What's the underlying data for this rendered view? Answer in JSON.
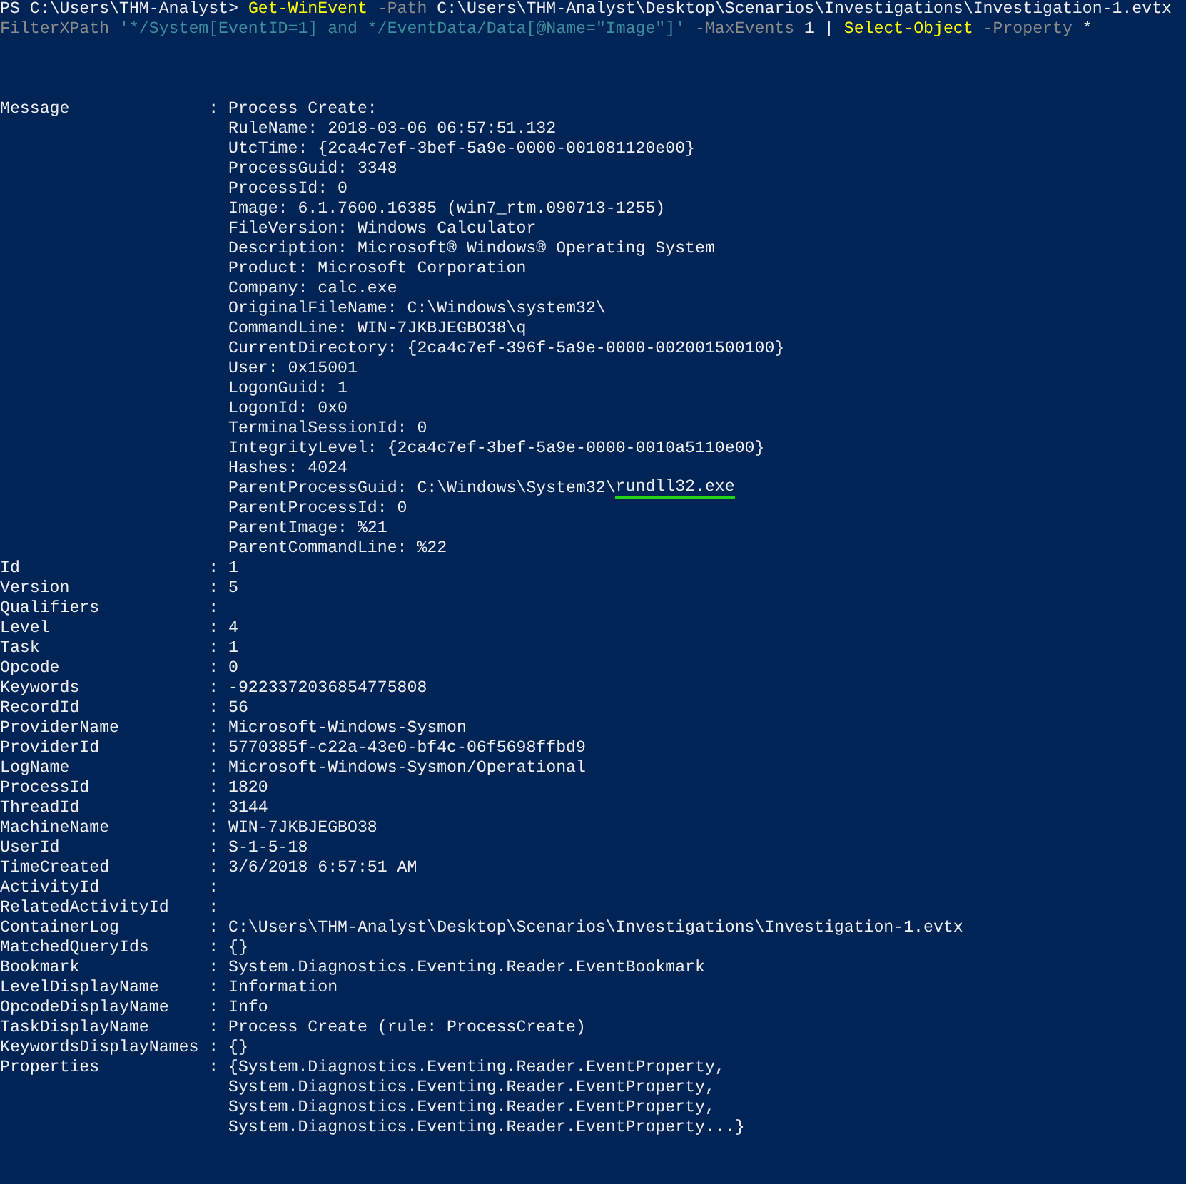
{
  "command": [
    [
      {
        "kind": "prompt",
        "text": "PS C:\\Users\\THM-Analyst> "
      },
      {
        "kind": "cmdlet",
        "text": "Get-WinEvent"
      },
      {
        "kind": "parameter",
        "text": " -Path"
      },
      {
        "kind": "argument",
        "text": " C:\\Users\\THM-Analyst\\Desktop\\Scenarios\\Investigations\\Investigation-1.evtx"
      }
    ],
    [
      {
        "kind": "parameter",
        "text": "FilterXPath"
      },
      {
        "kind": "string",
        "text": " '*/System[EventID=1] and */EventData/Data[@Name=\"Image\"]'"
      },
      {
        "kind": "parameter",
        "text": " -MaxEvents"
      },
      {
        "kind": "argument",
        "text": " 1"
      },
      {
        "kind": "argument",
        "text": " |"
      },
      {
        "kind": "cmdlet",
        "text": " Select-Object"
      },
      {
        "kind": "parameter",
        "text": " -Property"
      },
      {
        "kind": "argument",
        "text": " *"
      }
    ]
  ],
  "properties": [
    {
      "name": "Message",
      "sep": ":",
      "lines": [
        "Process Create:",
        "RuleName: 2018-03-06 06:57:51.132",
        "UtcTime: {2ca4c7ef-3bef-5a9e-0000-001081120e00}",
        "ProcessGuid: 3348",
        "ProcessId: 0",
        "Image: 6.1.7600.16385 (win7_rtm.090713-1255)",
        "FileVersion: Windows Calculator",
        "Description: Microsoft® Windows® Operating System",
        "Product: Microsoft Corporation",
        "Company: calc.exe",
        "OriginalFileName: C:\\Windows\\system32\\",
        "CommandLine: WIN-7JKBJEGBO38\\q",
        "CurrentDirectory: {2ca4c7ef-396f-5a9e-0000-002001500100}",
        "User: 0x15001",
        "LogonGuid: 1",
        "LogonId: 0x0",
        "TerminalSessionId: 0",
        "IntegrityLevel: {2ca4c7ef-3bef-5a9e-0000-0010a5110e00}",
        "Hashes: 4024",
        [
          {
            "text": "ParentProcessGuid: C:\\Windows\\System32\\",
            "underlined": false
          },
          {
            "text": "rundll32.exe",
            "underlined": true
          }
        ],
        "ParentProcessId: 0",
        "ParentImage: %21",
        "ParentCommandLine: %22"
      ]
    },
    {
      "name": "Id",
      "sep": ":",
      "lines": [
        "1"
      ]
    },
    {
      "name": "Version",
      "sep": ":",
      "lines": [
        "5"
      ]
    },
    {
      "name": "Qualifiers",
      "sep": ":"
    },
    {
      "name": "Level",
      "sep": ":",
      "lines": [
        "4"
      ]
    },
    {
      "name": "Task",
      "sep": ":",
      "lines": [
        "1"
      ]
    },
    {
      "name": "Opcode",
      "sep": ":",
      "lines": [
        "0"
      ]
    },
    {
      "name": "Keywords",
      "sep": ":",
      "lines": [
        "-9223372036854775808"
      ]
    },
    {
      "name": "RecordId",
      "sep": ":",
      "lines": [
        "56"
      ]
    },
    {
      "name": "ProviderName",
      "sep": ":",
      "lines": [
        "Microsoft-Windows-Sysmon"
      ]
    },
    {
      "name": "ProviderId",
      "sep": ":",
      "lines": [
        "5770385f-c22a-43e0-bf4c-06f5698ffbd9"
      ]
    },
    {
      "name": "LogName",
      "sep": ":",
      "lines": [
        "Microsoft-Windows-Sysmon/Operational"
      ]
    },
    {
      "name": "ProcessId",
      "sep": ":",
      "lines": [
        "1820"
      ]
    },
    {
      "name": "ThreadId",
      "sep": ":",
      "lines": [
        "3144"
      ]
    },
    {
      "name": "MachineName",
      "sep": ":",
      "lines": [
        "WIN-7JKBJEGBO38"
      ]
    },
    {
      "name": "UserId",
      "sep": ":",
      "lines": [
        "S-1-5-18"
      ]
    },
    {
      "name": "TimeCreated",
      "sep": ":",
      "lines": [
        "3/6/2018 6:57:51 AM"
      ]
    },
    {
      "name": "ActivityId",
      "sep": ":"
    },
    {
      "name": "RelatedActivityId",
      "sep": ":"
    },
    {
      "name": "ContainerLog",
      "sep": ":",
      "lines": [
        "C:\\Users\\THM-Analyst\\Desktop\\Scenarios\\Investigations\\Investigation-1.evtx"
      ]
    },
    {
      "name": "MatchedQueryIds",
      "sep": ":",
      "lines": [
        "{}"
      ]
    },
    {
      "name": "Bookmark",
      "sep": ":",
      "lines": [
        "System.Diagnostics.Eventing.Reader.EventBookmark"
      ]
    },
    {
      "name": "LevelDisplayName",
      "sep": ":",
      "lines": [
        "Information"
      ]
    },
    {
      "name": "OpcodeDisplayName",
      "sep": ":",
      "lines": [
        "Info"
      ]
    },
    {
      "name": "TaskDisplayName",
      "sep": ":",
      "lines": [
        "Process Create (rule: ProcessCreate)"
      ]
    },
    {
      "name": "KeywordsDisplayNames",
      "sep": ":",
      "lines": [
        "{}"
      ]
    },
    {
      "name": "Properties",
      "sep": ":",
      "lines": [
        "{System.Diagnostics.Eventing.Reader.EventProperty,",
        "System.Diagnostics.Eventing.Reader.EventProperty,",
        "System.Diagnostics.Eventing.Reader.EventProperty,",
        "System.Diagnostics.Eventing.Reader.EventProperty...}"
      ]
    }
  ]
}
